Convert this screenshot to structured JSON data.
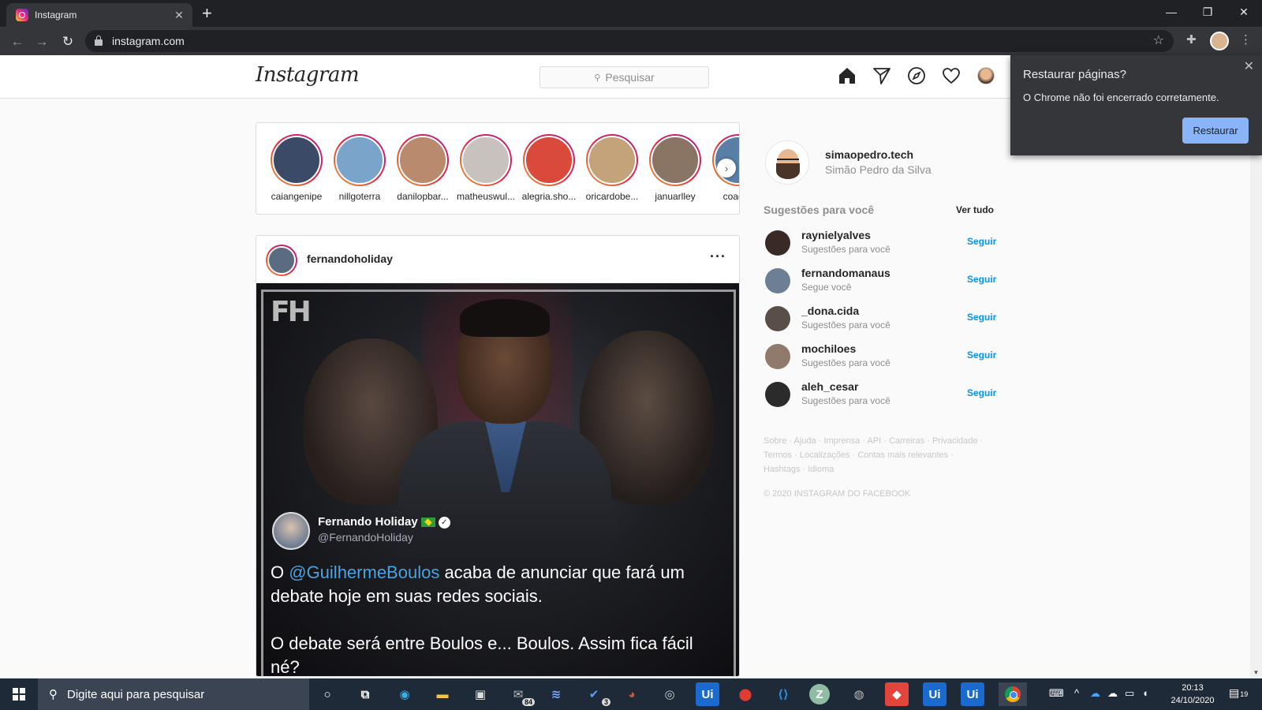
{
  "browser": {
    "tab_title": "Instagram",
    "url": "instagram.com"
  },
  "instagram": {
    "logo": "Instagram",
    "search_placeholder": "Pesquisar",
    "stories": [
      {
        "name": "caiangenipe",
        "color": "#3b4a66"
      },
      {
        "name": "nillgoterra",
        "color": "#7aa4c9"
      },
      {
        "name": "danilopbar...",
        "color": "#b98a6e"
      },
      {
        "name": "matheuswul...",
        "color": "#c7c2bd"
      },
      {
        "name": "alegria.sho...",
        "color": "#d94a3b"
      },
      {
        "name": "oricardobe...",
        "color": "#c4a27a"
      },
      {
        "name": "januarlley",
        "color": "#8a7565"
      },
      {
        "name": "coacha",
        "color": "#5a7fa6"
      }
    ],
    "post": {
      "username": "fernandoholiday",
      "image_logo": "FH",
      "tweet_name": "Fernando Holiday",
      "tweet_handle": "@FernandoHoliday",
      "tweet_prefix": "O ",
      "tweet_mention": "@GuilhermeBoulos",
      "tweet_rest": " acaba de anunciar que fará um debate hoje em suas redes sociais.",
      "tweet_line2": "O debate será entre Boulos e... Boulos. Assim fica fácil né?"
    },
    "me": {
      "username": "simaopedro.tech",
      "full_name": "Simão Pedro da Silva"
    },
    "suggestions_title": "Sugestões para você",
    "see_all": "Ver tudo",
    "suggestions": [
      {
        "username": "raynielyalves",
        "sub": "Sugestões para você",
        "follow": "Seguir",
        "color": "#3a2a26"
      },
      {
        "username": "fernandomanaus",
        "sub": "Segue você",
        "follow": "Seguir",
        "color": "#6d7f94"
      },
      {
        "username": "_dona.cida",
        "sub": "Sugestões para você",
        "follow": "Seguir",
        "color": "#5a4f48"
      },
      {
        "username": "mochiloes",
        "sub": "Sugestões para você",
        "follow": "Seguir",
        "color": "#8f7a6c"
      },
      {
        "username": "aleh_cesar",
        "sub": "Sugestões para você",
        "follow": "Seguir",
        "color": "#2b2b2b"
      }
    ],
    "footer_links": "Sobre · Ajuda · Imprensa · API · Carreiras · Privacidade · Termos · Localizações · Contas mais relevantes · Hashtags · Idioma",
    "footer_copy": "© 2020 INSTAGRAM DO FACEBOOK"
  },
  "restore_popup": {
    "title": "Restaurar páginas?",
    "message": "O Chrome não foi encerrado corretamente.",
    "button": "Restaurar"
  },
  "taskbar": {
    "search_placeholder": "Digite aqui para pesquisar",
    "mail_badge": "84",
    "todo_badge": "3",
    "time": "20:13",
    "date": "24/10/2020",
    "notifications": "19"
  }
}
